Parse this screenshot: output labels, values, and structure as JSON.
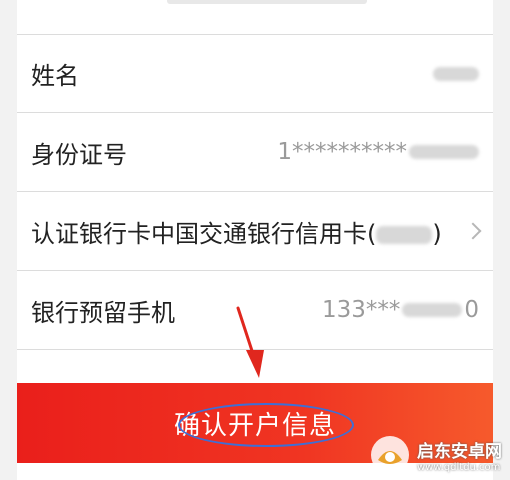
{
  "form": {
    "name": {
      "label": "姓名",
      "value": ""
    },
    "id_number": {
      "label": "身份证号",
      "value": "1**********"
    },
    "bank_card": {
      "label": "认证银行卡中国交通银行信用卡(",
      "suffix": ")"
    },
    "phone": {
      "label": "银行预留手机",
      "value": "133***",
      "tail": "0"
    }
  },
  "confirm_button": {
    "label": "确认开户信息"
  },
  "annotation": {
    "arrow_color": "#e0271e",
    "circle_color": "#3d6fd6"
  },
  "watermark": {
    "title": "启东安卓网",
    "url": "www.qdltdu.com"
  },
  "colors": {
    "accent": "#ea1f1b",
    "text": "#222222",
    "muted": "#9a9a9a",
    "divider": "#dcdcdc"
  }
}
